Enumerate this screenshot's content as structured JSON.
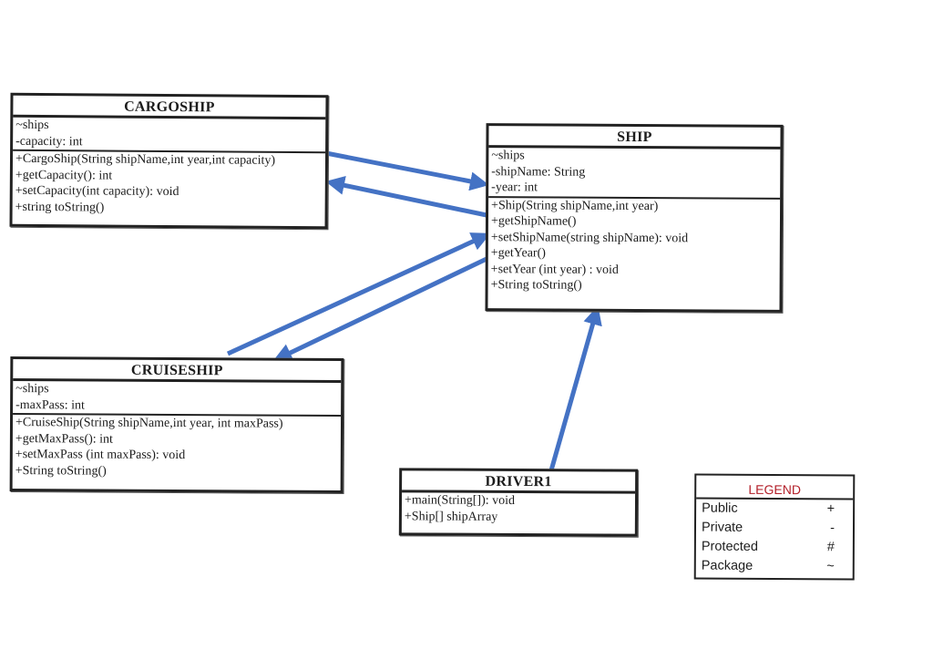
{
  "diagram": {
    "type": "UML class diagram",
    "arrow_color": "#4472c4",
    "classes": {
      "cargoship": {
        "name": "CARGOSHIP",
        "attributes": [
          "~ships",
          "-capacity: int"
        ],
        "methods": [
          "+CargoShip(String shipName,int year,int capacity)",
          "+getCapacity(): int",
          "+setCapacity(int capacity): void",
          "+string toString()"
        ]
      },
      "ship": {
        "name": "SHIP",
        "attributes": [
          "~ships",
          "-shipName: String",
          "-year: int"
        ],
        "methods": [
          "+Ship(String shipName,int year)",
          "+getShipName()",
          "+setShipName(string shipName): void",
          "+getYear()",
          "+setYear (int year) : void",
          "+String toString()"
        ]
      },
      "cruiseship": {
        "name": "CRUISESHIP",
        "attributes": [
          "~ships",
          "-maxPass: int"
        ],
        "methods": [
          "+CruiseShip(String shipName,int year, int maxPass)",
          "+getMaxPass(): int",
          "+setMaxPass (int maxPass): void",
          "+String toString()"
        ]
      },
      "driver1": {
        "name": "DRIVER1",
        "attributes": [],
        "methods": [
          "+main(String[]): void",
          "+Ship[] shipArray"
        ]
      }
    },
    "relationships": [
      {
        "from": "CARGOSHIP",
        "to": "SHIP"
      },
      {
        "from": "SHIP",
        "to": "CARGOSHIP"
      },
      {
        "from": "CRUISESHIP",
        "to": "SHIP"
      },
      {
        "from": "SHIP",
        "to": "CRUISESHIP"
      },
      {
        "from": "DRIVER1",
        "to": "SHIP"
      }
    ],
    "legend": {
      "title": "LEGEND",
      "title_color": "#b3202a",
      "rows": [
        {
          "label": "Public",
          "symbol": "+"
        },
        {
          "label": "Private",
          "symbol": "-"
        },
        {
          "label": "Protected",
          "symbol": "#"
        },
        {
          "label": "Package",
          "symbol": "~"
        }
      ]
    }
  }
}
